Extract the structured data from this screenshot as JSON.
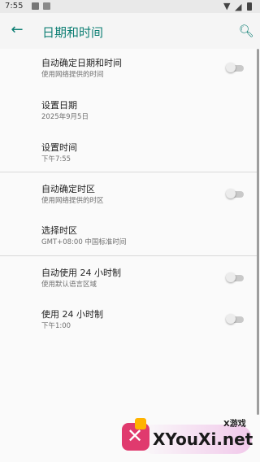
{
  "status_bar": {
    "time": "7:55"
  },
  "app_bar": {
    "title": "日期和时间"
  },
  "settings": [
    {
      "title": "自动确定日期和时间",
      "subtitle": "使用网络提供的时间"
    },
    {
      "title": "设置日期",
      "subtitle": "2025年9月5日"
    },
    {
      "title": "设置时间",
      "subtitle": "下午7:55"
    },
    {
      "title": "自动确定时区",
      "subtitle": "使用网络提供的时区"
    },
    {
      "title": "选择时区",
      "subtitle": "GMT+08:00 中国标准时间"
    },
    {
      "title": "自动使用 24 小时制",
      "subtitle": "使用默认语言区域"
    },
    {
      "title": "使用 24 小时制",
      "subtitle": "下午1:00"
    }
  ],
  "watermark": {
    "cn": "X游戏",
    "en": "XYouXi.net"
  }
}
